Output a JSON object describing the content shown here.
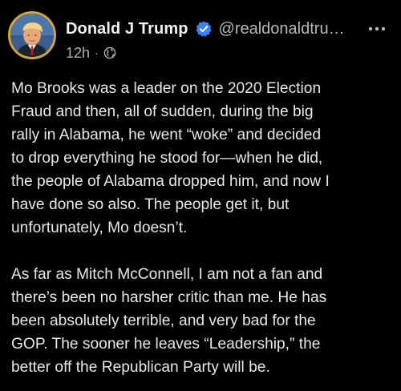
{
  "post": {
    "author": {
      "display_name": "Donald J Trump",
      "handle": "@realdonaldtru…",
      "verified": true,
      "avatar_icon": "profile-photo"
    },
    "timestamp": "12h",
    "separator": "·",
    "visibility_icon": "globe-icon",
    "more_icon": "more-horizontal-icon",
    "paragraphs": [
      "Mo Brooks was a leader on the 2020 Election\nFraud and then, all of sudden, during the big\nrally in Alabama, he went “woke” and decided\nto drop everything he stood for—when he did,\nthe people of Alabama dropped him, and now I\nhave done so also. The people get it, but\nunfortunately, Mo doesn’t.",
      "As far as Mitch McConnell, I am not a fan and\nthere’s been no harsher critic than me. He has\nbeen absolutely terrible, and very bad for the\nGOP. The sooner he leaves “Leadership,” the\nbetter off the Republican Party will be."
    ]
  },
  "colors": {
    "background": "#000000",
    "text": "#e8e8e8",
    "muted": "#b0b0b0",
    "verified_badge": "#3b82f6",
    "avatar_ring": "#d6a33c"
  }
}
